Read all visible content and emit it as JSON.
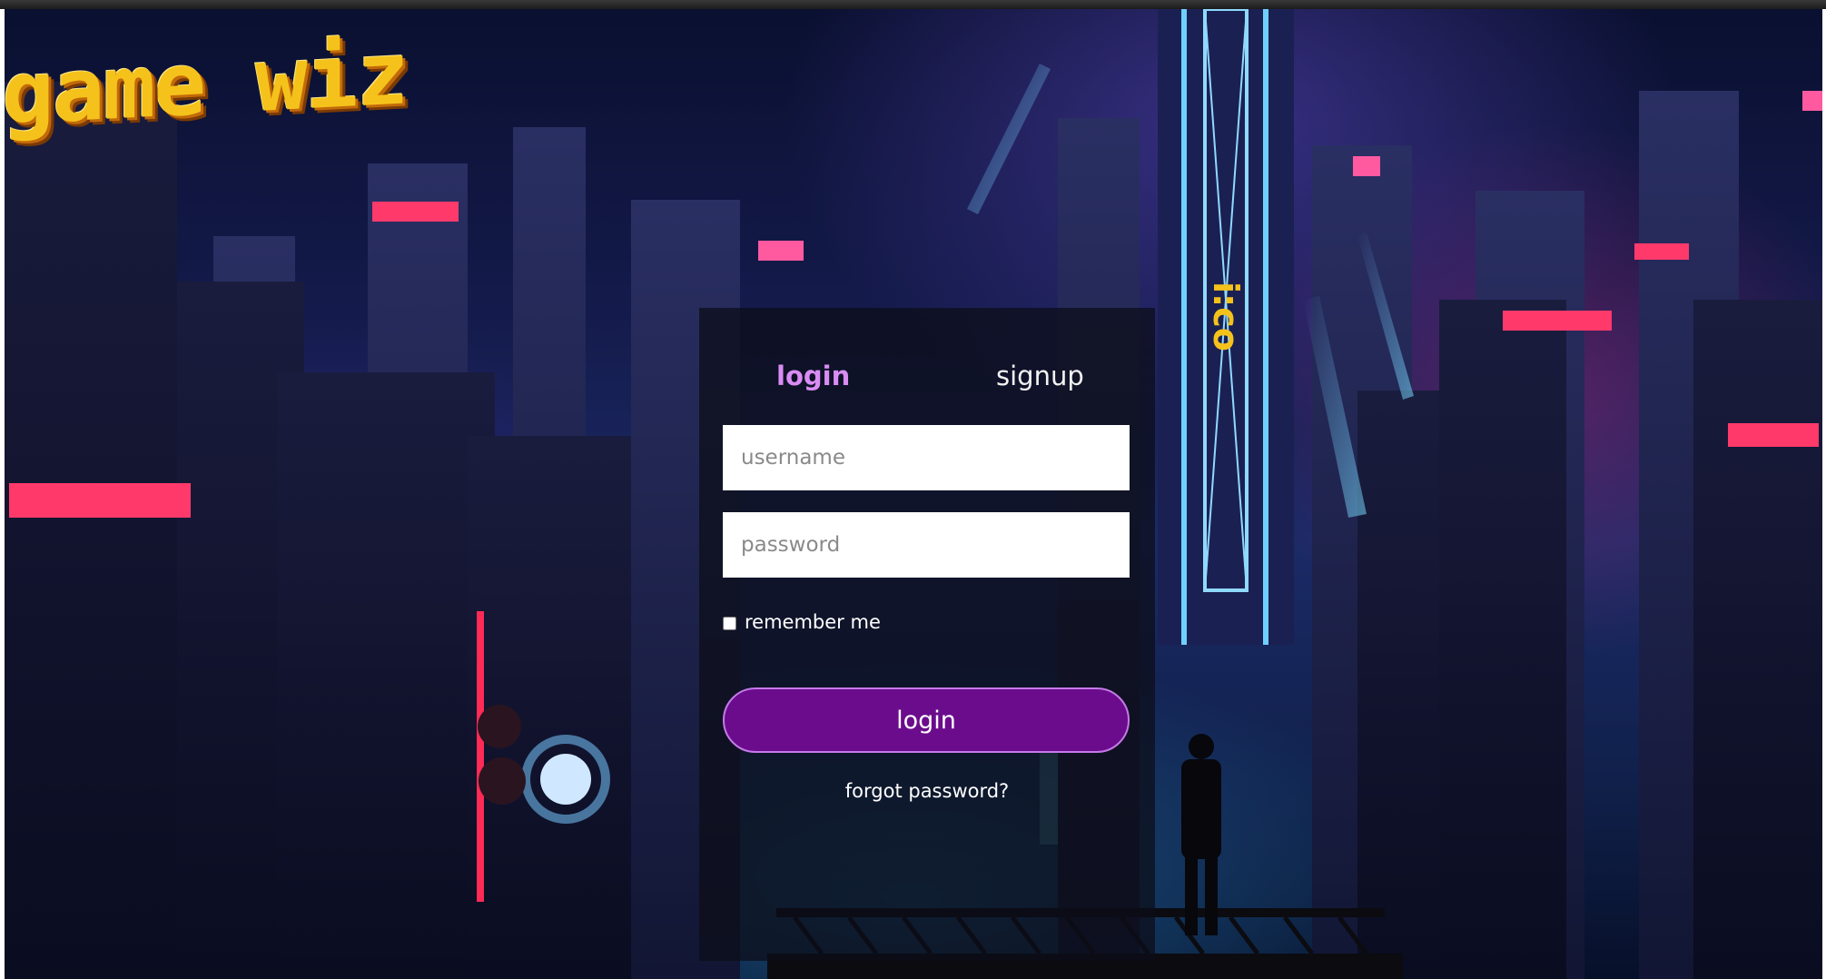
{
  "app": {
    "logo_text": "game wiz"
  },
  "tabs": [
    {
      "label": "login",
      "active": true
    },
    {
      "label": "signup",
      "active": false
    }
  ],
  "form": {
    "username_placeholder": "username",
    "password_placeholder": "password",
    "remember_label": "remember me",
    "remember_checked": false,
    "submit_label": "login",
    "forgot_label": "forgot password?"
  },
  "colors": {
    "accent_tab": "#d98cf3",
    "button_fill": "#6b0c8d",
    "button_border": "#c57ae8",
    "logo": "#f5c21b"
  }
}
